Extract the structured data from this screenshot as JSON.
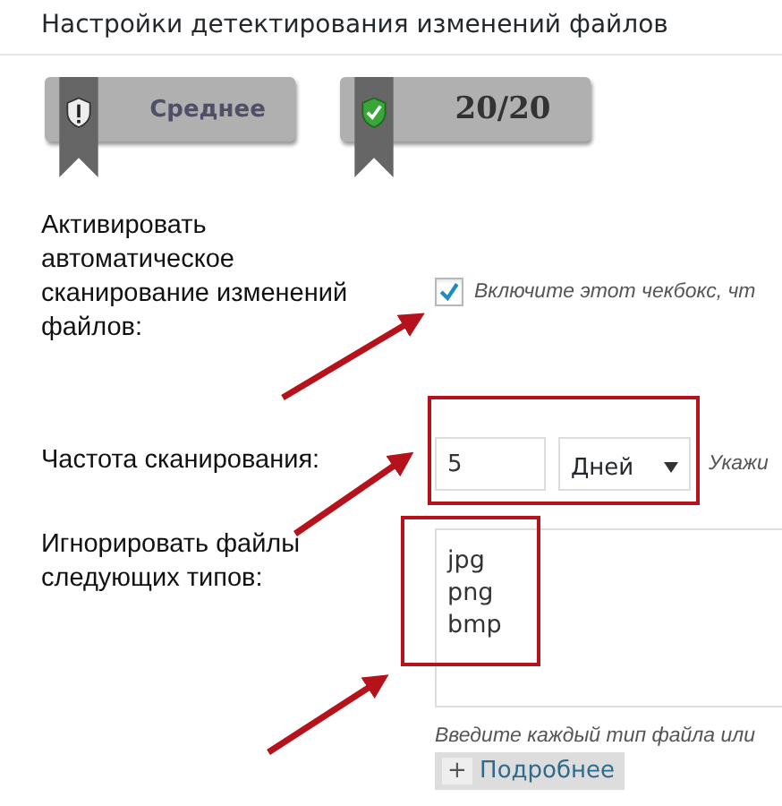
{
  "section_title": "Настройки детектирования изменений файлов",
  "badges": [
    {
      "kind": "warning",
      "label": "Среднее"
    },
    {
      "kind": "ok",
      "label": "20/20"
    }
  ],
  "settings": [
    {
      "kind": "checkbox",
      "label": "Активировать автоматическое сканирование изменений файлов:",
      "checked": true,
      "description": "Включите этот чекбокс, чт"
    },
    {
      "kind": "interval",
      "label": "Частота сканирования:",
      "value": "5",
      "unit": "Дней",
      "description": "Укажи"
    },
    {
      "kind": "textarea",
      "label": "Игнорировать файлы следующих типов:",
      "lines": [
        "jpg",
        "png",
        "bmp"
      ],
      "description": "Введите каждый тип файла или",
      "more_icon": "+",
      "more_button": "Подробнее"
    }
  ]
}
